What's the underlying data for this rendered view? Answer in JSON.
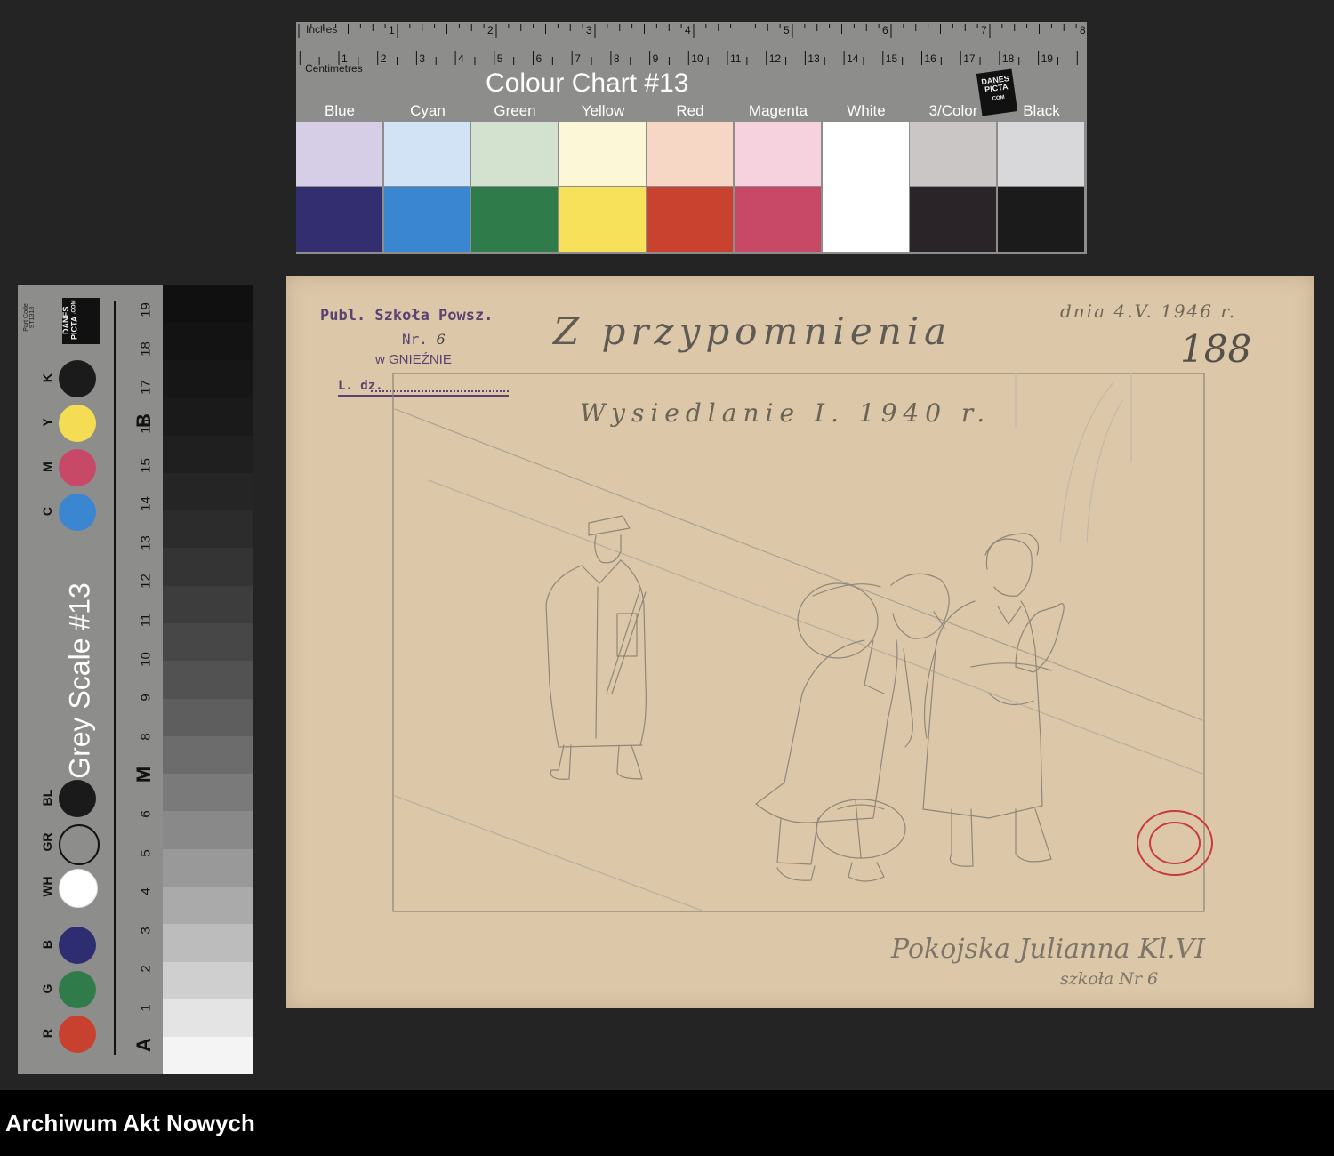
{
  "colour_chart": {
    "title": "Colour Chart #13",
    "ruler": {
      "inches_label": "Inches",
      "centimetres_label": "Centimetres",
      "inch_marks": [
        "1",
        "2",
        "3",
        "4",
        "5",
        "6",
        "7",
        "8"
      ],
      "cm_marks": [
        "1",
        "2",
        "3",
        "4",
        "5",
        "6",
        "7",
        "8",
        "9",
        "10",
        "11",
        "12",
        "13",
        "14",
        "15",
        "16",
        "17",
        "18",
        "19"
      ]
    },
    "logo": "DANES PICTA",
    "logo_sub": ".COM",
    "columns": [
      {
        "name": "Blue",
        "light": "#d6cde6",
        "dark": "#322e6f"
      },
      {
        "name": "Cyan",
        "light": "#d3e3f6",
        "dark": "#3a86d0"
      },
      {
        "name": "Green",
        "light": "#d3e1cf",
        "dark": "#2f7b49"
      },
      {
        "name": "Yellow",
        "light": "#fbf7d7",
        "dark": "#f7e05a"
      },
      {
        "name": "Red",
        "light": "#f6d6c4",
        "dark": "#c9412f"
      },
      {
        "name": "Magenta",
        "light": "#f5d2de",
        "dark": "#c84868"
      },
      {
        "name": "White",
        "light": "#ffffff",
        "dark": "#ffffff"
      },
      {
        "name": "3/Color",
        "light": "#cbc6c6",
        "dark": "#2a2327"
      },
      {
        "name": "Black",
        "light": "#d8d8da",
        "dark": "#1b1b1b"
      }
    ]
  },
  "grey_scale": {
    "title": "Grey Scale #13",
    "logo": "DANES PICTA",
    "logo_sub": ".COM",
    "part_code": "Part Code ST1318",
    "patches": [
      {
        "label": "R",
        "color": "#c8402e"
      },
      {
        "label": "G",
        "color": "#2f7b49"
      },
      {
        "label": "B",
        "color": "#2e2d72"
      },
      {
        "label": "WH",
        "color": "#ffffff"
      },
      {
        "label": "GR",
        "color": "#8d8d8b"
      },
      {
        "label": "BL",
        "color": "#1a1a1a"
      },
      {
        "label": "K",
        "color": "#1b1b1b"
      },
      {
        "label": "Y",
        "color": "#f4dd54"
      },
      {
        "label": "M",
        "color": "#c84868"
      },
      {
        "label": "C",
        "color": "#3a86d0"
      }
    ],
    "numbers": [
      "1",
      "2",
      "3",
      "4",
      "5",
      "6",
      "7",
      "8",
      "9",
      "10",
      "11",
      "12",
      "13",
      "14",
      "15",
      "16",
      "17",
      "18",
      "19"
    ],
    "letters": [
      "A",
      "M",
      "B"
    ],
    "steps": [
      "#f4f4f4",
      "#e4e4e4",
      "#cfcfcf",
      "#bcbcbc",
      "#aaaaaa",
      "#999999",
      "#898989",
      "#7a7a7a",
      "#6c6c6c",
      "#5e5e5e",
      "#525252",
      "#474747",
      "#3d3d3d",
      "#343434",
      "#2c2c2c",
      "#252525",
      "#1f1f1f",
      "#1a1a1a",
      "#161616",
      "#131313",
      "#101010"
    ]
  },
  "document": {
    "stamp": {
      "line1": "Publ. Szkoła Powsz.",
      "line2_prefix": "Nr.",
      "line2_number": "6",
      "line3": "w GNIEŹNIE",
      "line4": "L. dz."
    },
    "heading": "Z przypomnienia",
    "date": "dnia 4.V. 1946 r.",
    "page_number": "188",
    "drawing_title": "Wysiedlanie I. 1940 r.",
    "signature_line1": "Pokojska Julianna Kl.VI",
    "signature_line2": "szkoła Nr 6"
  },
  "footer": {
    "brand": "Archiwum Akt Nowych"
  }
}
